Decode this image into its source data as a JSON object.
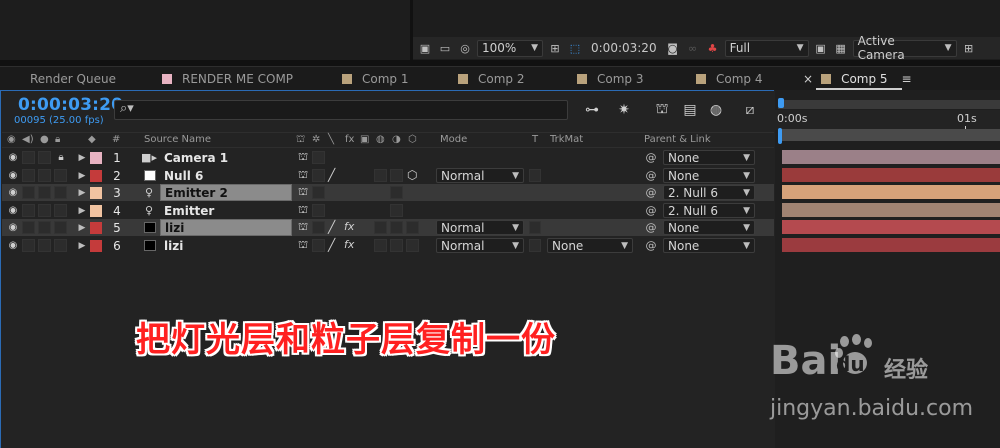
{
  "viewer": {
    "zoom": "100%",
    "timecode": "0:00:03:20",
    "resolution": "Full",
    "camera": "Active Camera"
  },
  "tabs": [
    {
      "label": "Render Queue",
      "color": ""
    },
    {
      "label": "RENDER ME COMP",
      "color": "#e8b3c2"
    },
    {
      "label": "Comp 1",
      "color": "#b9a27c"
    },
    {
      "label": "Comp 2",
      "color": "#b9a27c"
    },
    {
      "label": "Comp 3",
      "color": "#b9a27c"
    },
    {
      "label": "Comp 4",
      "color": "#b9a27c"
    },
    {
      "label": "Comp 5",
      "color": "#b9a27c",
      "active": true
    }
  ],
  "tab_close": "×",
  "tab_menu": "≡",
  "timeline": {
    "timecode": "0:00:03:20",
    "frames": "00095 (25.00 fps)",
    "search_glyph": "⌕▾"
  },
  "columns": {
    "num": "#",
    "source": "Source Name",
    "mode": "Mode",
    "t": "T",
    "trkmat": "TrkMat",
    "parent": "Parent & Link",
    "fx": "fx"
  },
  "layers": [
    {
      "num": "1",
      "name": "Camera 1",
      "label_color": "#e8b3c2",
      "type": "camera-icon",
      "mode": "",
      "trkmat": "",
      "parent": "None",
      "track_color": "#9b8088",
      "locked": true,
      "highlighted": false,
      "boxed": false,
      "switches": false
    },
    {
      "num": "2",
      "name": "Null 6",
      "label_color": "#c43b3b",
      "type": "null-icon",
      "mode": "Normal",
      "trkmat": "",
      "parent": "None",
      "track_color": "#9a3b3b",
      "locked": false,
      "highlighted": false,
      "boxed": false,
      "switches": true
    },
    {
      "num": "3",
      "name": "Emitter 2",
      "label_color": "#f1c3a1",
      "type": "light-icon",
      "mode": "",
      "trkmat": "",
      "parent": "2. Null 6",
      "track_color": "#d6a27a",
      "locked": false,
      "highlighted": true,
      "boxed": true,
      "switches": false
    },
    {
      "num": "4",
      "name": "Emitter",
      "label_color": "#f1c3a1",
      "type": "light-icon",
      "mode": "",
      "trkmat": "",
      "parent": "2. Null 6",
      "track_color": "#a08372",
      "locked": false,
      "highlighted": false,
      "boxed": false,
      "switches": false
    },
    {
      "num": "5",
      "name": "lizi",
      "label_color": "#c43b3b",
      "type": "solid-icon",
      "mode": "Normal",
      "trkmat": "",
      "parent": "None",
      "track_color": "#b44a4f",
      "locked": false,
      "highlighted": true,
      "boxed": true,
      "switches": true
    },
    {
      "num": "6",
      "name": "lizi",
      "label_color": "#c43b3b",
      "type": "solid-icon",
      "mode": "Normal",
      "trkmat": "None",
      "parent": "None",
      "track_color": "#9b3b3f",
      "locked": false,
      "highlighted": false,
      "boxed": false,
      "switches": true
    }
  ],
  "ruler": {
    "start": "0:00s",
    "mark": "01s"
  },
  "caption": "把灯光层和粒子层复制一份",
  "watermark": {
    "logo": "Bai",
    "logo2": "du",
    "cn": "经验",
    "url": "jingyan.baidu.com"
  }
}
